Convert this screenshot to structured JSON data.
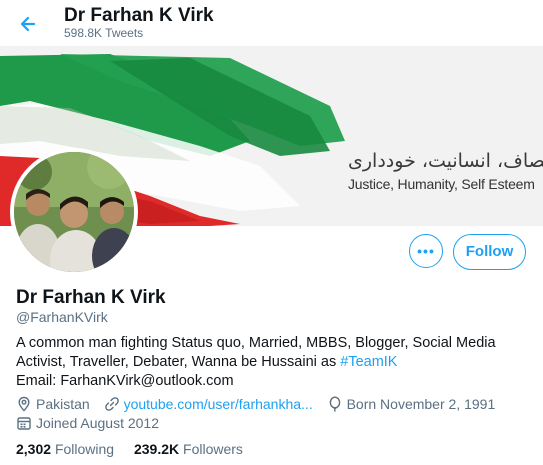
{
  "header": {
    "title": "Dr Farhan K Virk",
    "tweet_count": "598.8K Tweets"
  },
  "banner": {
    "urdu_text": "انصاف، انسانیت، خودداری",
    "english_text": "Justice, Humanity, Self Esteem",
    "colors": {
      "green": "#1f9a4a",
      "red": "#e02a2a",
      "background": "#f2f2f2"
    }
  },
  "actions": {
    "more_label": "•••",
    "follow_label": "Follow"
  },
  "profile": {
    "name": "Dr Farhan K Virk",
    "handle": "@FarhanKVirk",
    "bio_text": "A common man fighting Status quo, Married, MBBS, Blogger, Social Media Activist, Traveller, Debater, Wanna be Hussaini as ",
    "bio_hashtag": "#TeamIK",
    "email_line": "Email: FarhanKVirk@outlook.com",
    "location": "Pakistan",
    "website": "youtube.com/user/farhankha...",
    "birthday": "Born November 2, 1991",
    "joined": "Joined August 2012"
  },
  "stats": {
    "following_count": "2,302",
    "following_label": "Following",
    "followers_count": "239.2K",
    "followers_label": "Followers"
  },
  "icons": {
    "back": "arrow-left-icon",
    "location": "location-pin-icon",
    "link": "link-icon",
    "birthday": "balloon-icon",
    "calendar": "calendar-icon"
  },
  "accent_color": "#1da1f2"
}
